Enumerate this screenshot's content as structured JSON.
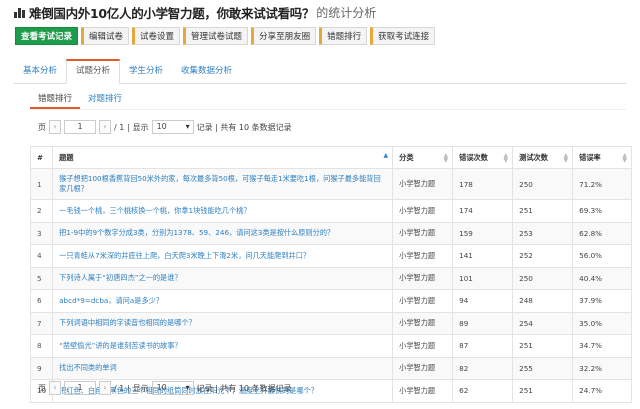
{
  "title": {
    "main": "难倒国内外10亿人的小学智力题，你敢来试试看吗？",
    "sub": "的统计分析"
  },
  "toolbar": [
    {
      "label": "查看考试记录",
      "primary": true
    },
    {
      "label": "编辑试卷"
    },
    {
      "label": "试卷设置"
    },
    {
      "label": "管理试卷试题"
    },
    {
      "label": "分享至朋友圈"
    },
    {
      "label": "错题排行"
    },
    {
      "label": "获取考试连接"
    }
  ],
  "main_tabs": [
    {
      "label": "基本分析"
    },
    {
      "label": "试题分析",
      "active": true
    },
    {
      "label": "学生分析"
    },
    {
      "label": "收集数据分析"
    }
  ],
  "sub_tabs": [
    {
      "label": "错题排行",
      "active": true
    },
    {
      "label": "对题排行"
    }
  ],
  "pager": {
    "page_label": "页",
    "prev": "‹",
    "next": "›",
    "current": "1",
    "total": "/ 1",
    "show_label": "| 显示",
    "per_page": "10",
    "summary": "记录 | 共有 10 条数据记录"
  },
  "table": {
    "headers": [
      "#",
      "题题",
      "分类",
      "错误次数",
      "测试次数",
      "错误率"
    ],
    "rows": [
      [
        "1",
        "猴子想把100根香蕉背回50米外的家，每次最多背50根，可猴子每走1米要吃1根，问猴子最多能背回家几根？",
        "小学智力题",
        "178",
        "250",
        "71.2%"
      ],
      [
        "2",
        "一毛钱一个桃，三个桃核换一个桃，你拿1块钱能吃几个桃？",
        "小学智力题",
        "174",
        "251",
        "69.3%"
      ],
      [
        "3",
        "把1-9中的9个数字分成3类，分别为1378、59、246，请问这3类是按什么原则分的？",
        "小学智力题",
        "159",
        "253",
        "62.8%"
      ],
      [
        "4",
        "一只青蛙从7米深的井底往上爬，白天爬3米晚上下滑2米，问几天能爬到井口？",
        "小学智力题",
        "141",
        "252",
        "56.0%"
      ],
      [
        "5",
        "下列诗人属于“初唐四杰”之一的是谁？",
        "小学智力题",
        "101",
        "250",
        "40.4%"
      ],
      [
        "6",
        "abcd*9=dcba，请问a是多少？",
        "小学智力题",
        "94",
        "248",
        "37.9%"
      ],
      [
        "7",
        "下列词语中相同的字读音也相同的是哪个？",
        "小学智力题",
        "89",
        "254",
        "35.0%"
      ],
      [
        "8",
        "“凿壁偷光”讲的是谁刻苦读书的故事？",
        "小学智力题",
        "87",
        "251",
        "34.7%"
      ],
      [
        "9",
        "找出不同类的单词",
        "小学智力题",
        "82",
        "255",
        "32.2%"
      ],
      [
        "10",
        "把红色、白色、黑色的三个相同的纸筒同时放在阳光下，温度上升最快的是哪个？",
        "小学智力题",
        "62",
        "251",
        "24.7%"
      ]
    ]
  }
}
